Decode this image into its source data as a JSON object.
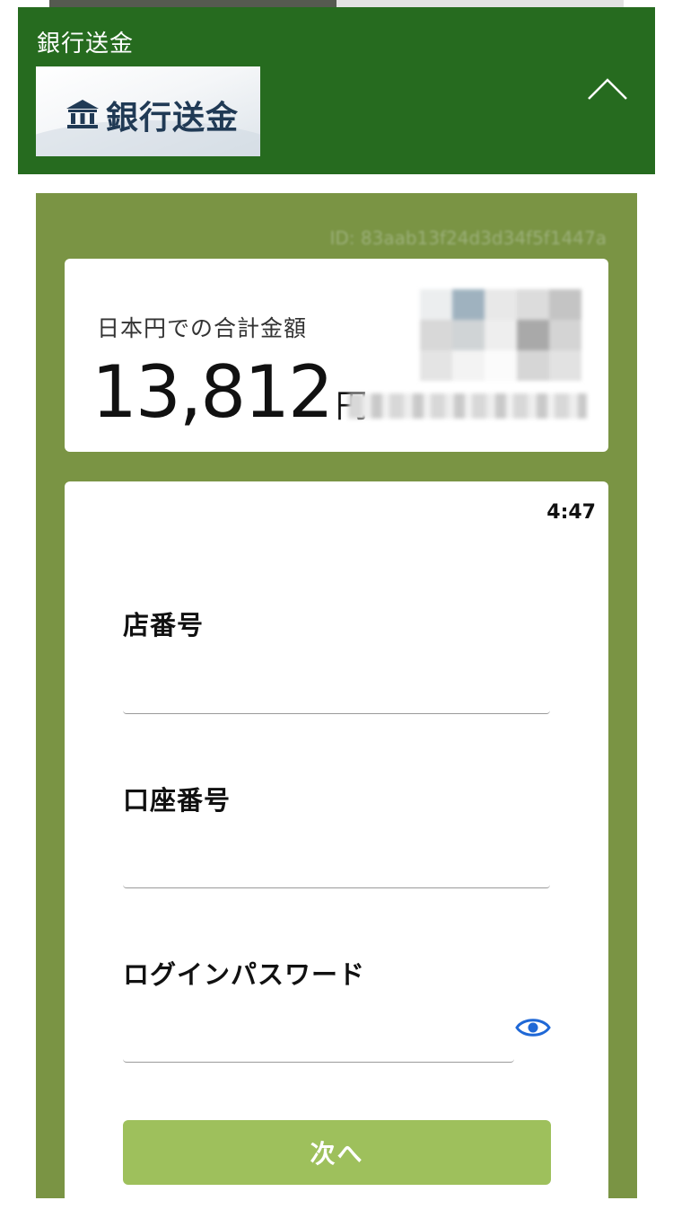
{
  "header": {
    "title": "銀行送金",
    "logo_text": "銀行送金",
    "bank_icon": "bank-building-icon",
    "toggle_icon": "chevron-up-icon"
  },
  "session": {
    "id_text": "ID: 83aab13f24d3d34f5f1447a"
  },
  "total": {
    "label": "日本円での合計金額",
    "value": "13,812",
    "unit": "円"
  },
  "form": {
    "timer": "4:47",
    "branch_label": "店番号",
    "branch_value": "",
    "account_label": "口座番号",
    "account_value": "",
    "password_label": "ログインパスワード",
    "password_value": "",
    "password_toggle_icon": "eye-icon",
    "next_label": "次へ"
  },
  "colors": {
    "header_bg": "#266b1f",
    "panel_bg": "#7a9444",
    "button_bg": "#9ec05c",
    "accent_blue": "#1f68d6"
  }
}
